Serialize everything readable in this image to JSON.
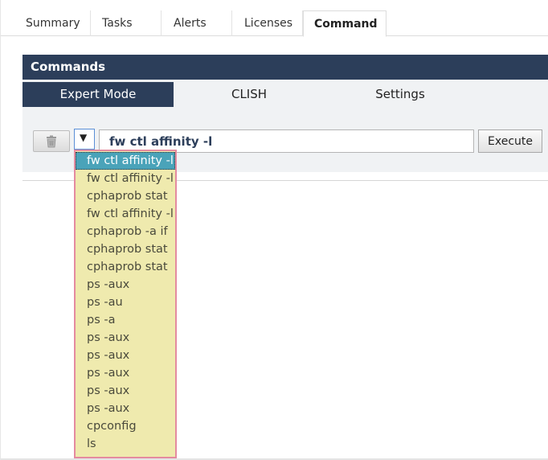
{
  "tabs": [
    {
      "label": "Summary",
      "active": false
    },
    {
      "label": "Tasks",
      "active": false
    },
    {
      "label": "Alerts",
      "active": false
    },
    {
      "label": "Licenses",
      "active": false
    },
    {
      "label": "Command",
      "active": true
    }
  ],
  "panel": {
    "title": "Commands",
    "modes": [
      {
        "label": "Expert Mode",
        "active": true
      },
      {
        "label": "CLISH",
        "active": false
      },
      {
        "label": "Settings",
        "active": false
      }
    ]
  },
  "command_bar": {
    "clear_icon": "trash-icon",
    "dropdown_arrow": "▼",
    "input_value": "fw ctl affinity -l",
    "execute_label": "Execute"
  },
  "history": {
    "selected_index": 0,
    "items": [
      "fw ctl affinity -l",
      "fw ctl affinity -l",
      "cphaprob stat",
      "fw ctl affinity -l",
      "cphaprob -a if",
      "cphaprob stat",
      "cphaprob stat",
      "ps -aux",
      "ps -au",
      "ps -a",
      "ps -aux",
      "ps -aux",
      "ps -aux",
      "ps -aux",
      "ps -aux",
      "cpconfig",
      "ls"
    ]
  },
  "colors": {
    "header_bg": "#2c3e5a",
    "dropdown_bg": "#efeaae",
    "dropdown_border": "#e48ba0",
    "selected_bg": "#4aa3b9"
  }
}
